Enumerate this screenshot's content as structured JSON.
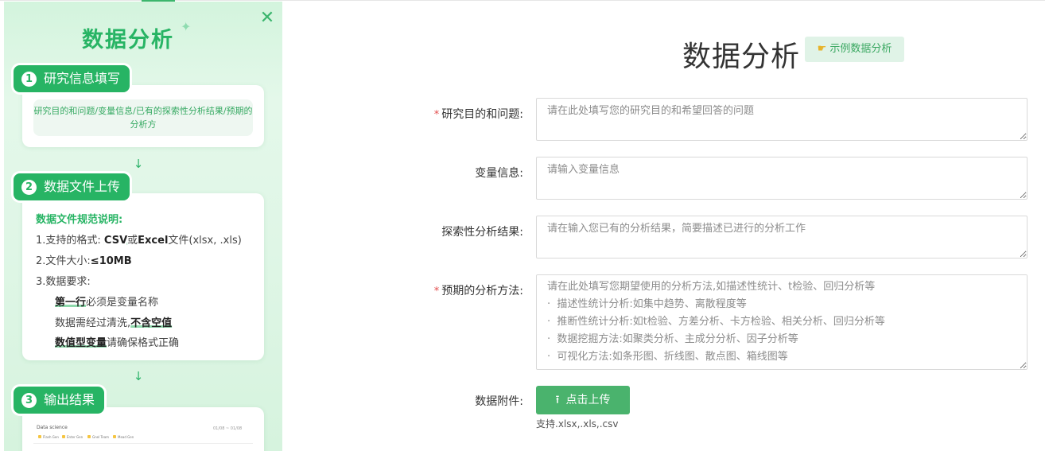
{
  "sidebar": {
    "title": "数据分析",
    "close_icon": "close-icon",
    "steps": [
      {
        "num": "1",
        "label": "研究信息填写"
      },
      {
        "num": "2",
        "label": "数据文件上传"
      },
      {
        "num": "3",
        "label": "输出结果"
      }
    ],
    "step1_desc": "研究目的和问题/变量信息/已有的探索性分析结果/预期的分析方",
    "spec": {
      "title": "数据文件规范说明:",
      "l1_pre": "1.支持的格式: ",
      "l1_csv": "CSV",
      "l1_or": "或",
      "l1_excel": "Excel",
      "l1_post": "文件(xlsx, .xls)",
      "l2_pre": "2.文件大小:",
      "l2_size": "≤10MB",
      "l3": "3.数据要求:",
      "l4_b": "第一行",
      "l4_post": "必须是变量名称",
      "l5_pre": "数据需经过清洗,",
      "l5_b": "不含空值",
      "l6_b": "数值型变量",
      "l6_post": "请确保格式正确"
    },
    "preview": {
      "title": "Data science",
      "date": "01/08 ~ 01/08",
      "pills": [
        "Flash Gen",
        "Enter Gen",
        "Gnel Team",
        "Mead Gen"
      ]
    }
  },
  "main": {
    "title": "数据分析",
    "example_button": "示例数据分析",
    "fields": [
      {
        "label": "研究目的和问题:",
        "required": "*",
        "placeholder": "请在此处填写您的研究目的和希望回答的问题"
      },
      {
        "label": "变量信息:",
        "required": "",
        "placeholder": "请输入变量信息"
      },
      {
        "label": "探索性分析结果:",
        "required": "",
        "placeholder": "请在输入您已有的分析结果，简要描述已进行的分析工作"
      },
      {
        "label": "预期的分析方法:",
        "required": "*",
        "placeholder": "请在此处填写您期望使用的分析方法,如描述性统计、t检验、回归分析等\n·  描述性统计分析:如集中趋势、离散程度等\n·  推断性统计分析:如t检验、方差分析、卡方检验、相关分析、回归分析等\n·  数据挖掘方法:如聚类分析、主成分分析、因子分析等\n·  可视化方法:如条形图、折线图、散点图、箱线图等"
      }
    ],
    "attachment_label": "数据附件:",
    "upload_button": "点击上传",
    "upload_hint": "支持.xlsx,.xls,.csv"
  },
  "colors": {
    "accent": "#27b464",
    "button": "#4ab36d",
    "required": "#e34d4d"
  }
}
